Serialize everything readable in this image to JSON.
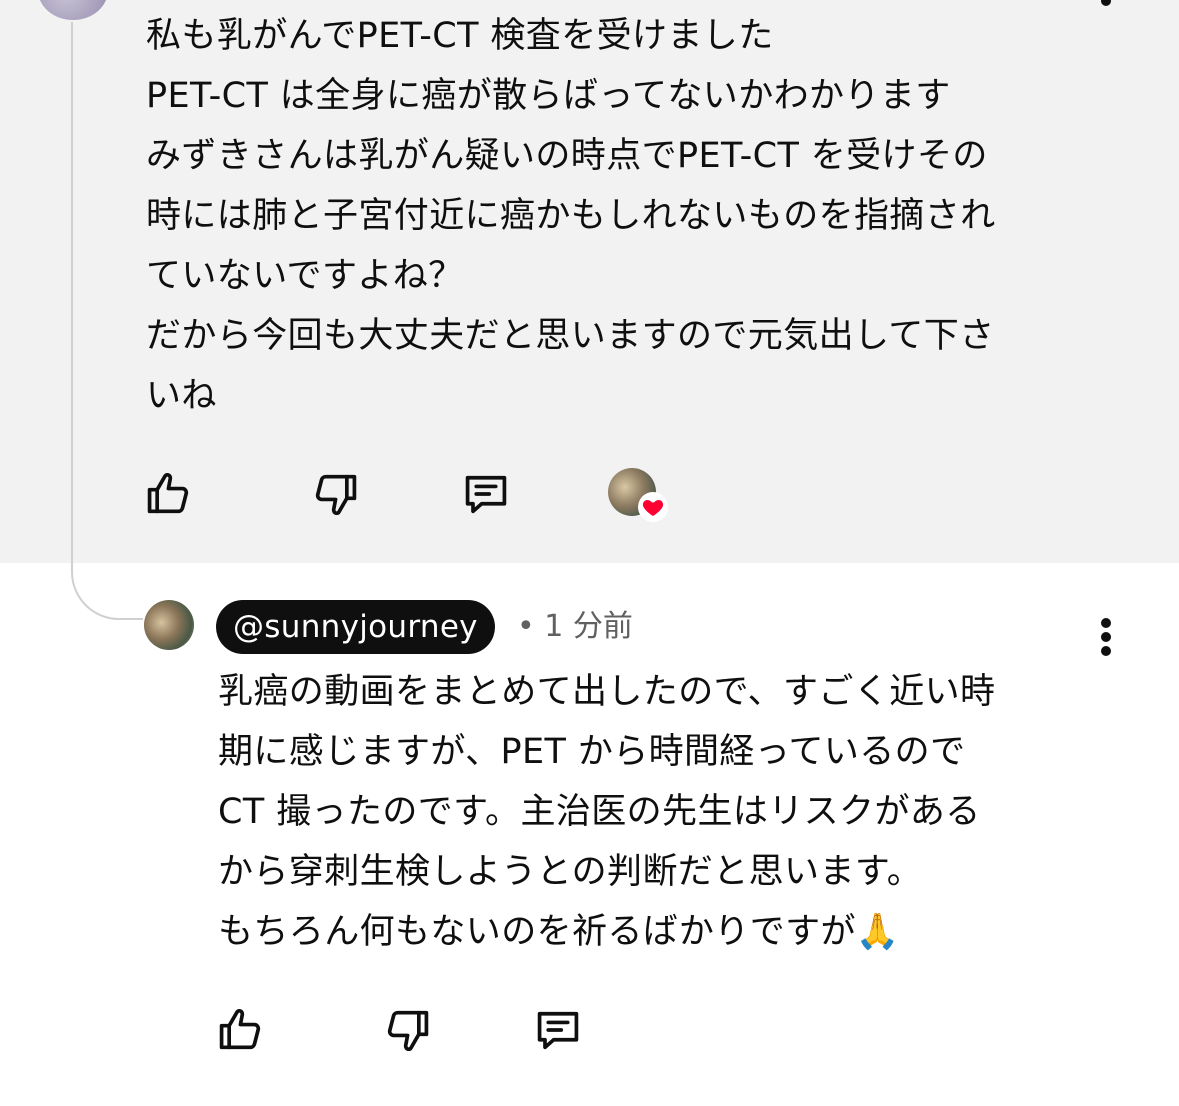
{
  "top_comment": {
    "lines": [
      "私も乳がんでPET-CT 検査を受けました",
      "PET-CT は全身に癌が散らばってないかわかります",
      "みずきさんは乳がん疑いの時点でPET-CT を受けその",
      "時には肺と子宮付近に癌かもしれないものを指摘され",
      "ていないですよね？",
      "だから今回も大丈夫だと思いますので元気出して下さ",
      "いね"
    ],
    "actions": {
      "like_icon": "thumbs-up-icon",
      "dislike_icon": "thumbs-down-icon",
      "reply_icon": "reply-comment-icon",
      "creator_heart_icon": "creator-heart-icon"
    }
  },
  "reply": {
    "author": "@sunnyjourney",
    "separator": "•",
    "time": "1 分前",
    "lines": [
      "乳癌の動画をまとめて出したので、すごく近い時",
      "期に感じますが、PET から時間経っているので",
      " CT 撮ったのです。主治医の先生はリスクがある",
      "から穿刺生検しようとの判断だと思います。",
      "もちろん何もないのを祈るばかりですが🙏"
    ],
    "actions": {
      "like_icon": "thumbs-up-icon",
      "dislike_icon": "thumbs-down-icon",
      "reply_icon": "reply-comment-icon"
    },
    "more_icon": "more-vertical-icon"
  },
  "colors": {
    "highlight_bg": "#f2f2f2",
    "text": "#0f0f0f",
    "meta_text": "#606060",
    "chip_bg": "#0f0f0f",
    "heart": "#ff0033",
    "thread_line": "#d0d0d0"
  }
}
